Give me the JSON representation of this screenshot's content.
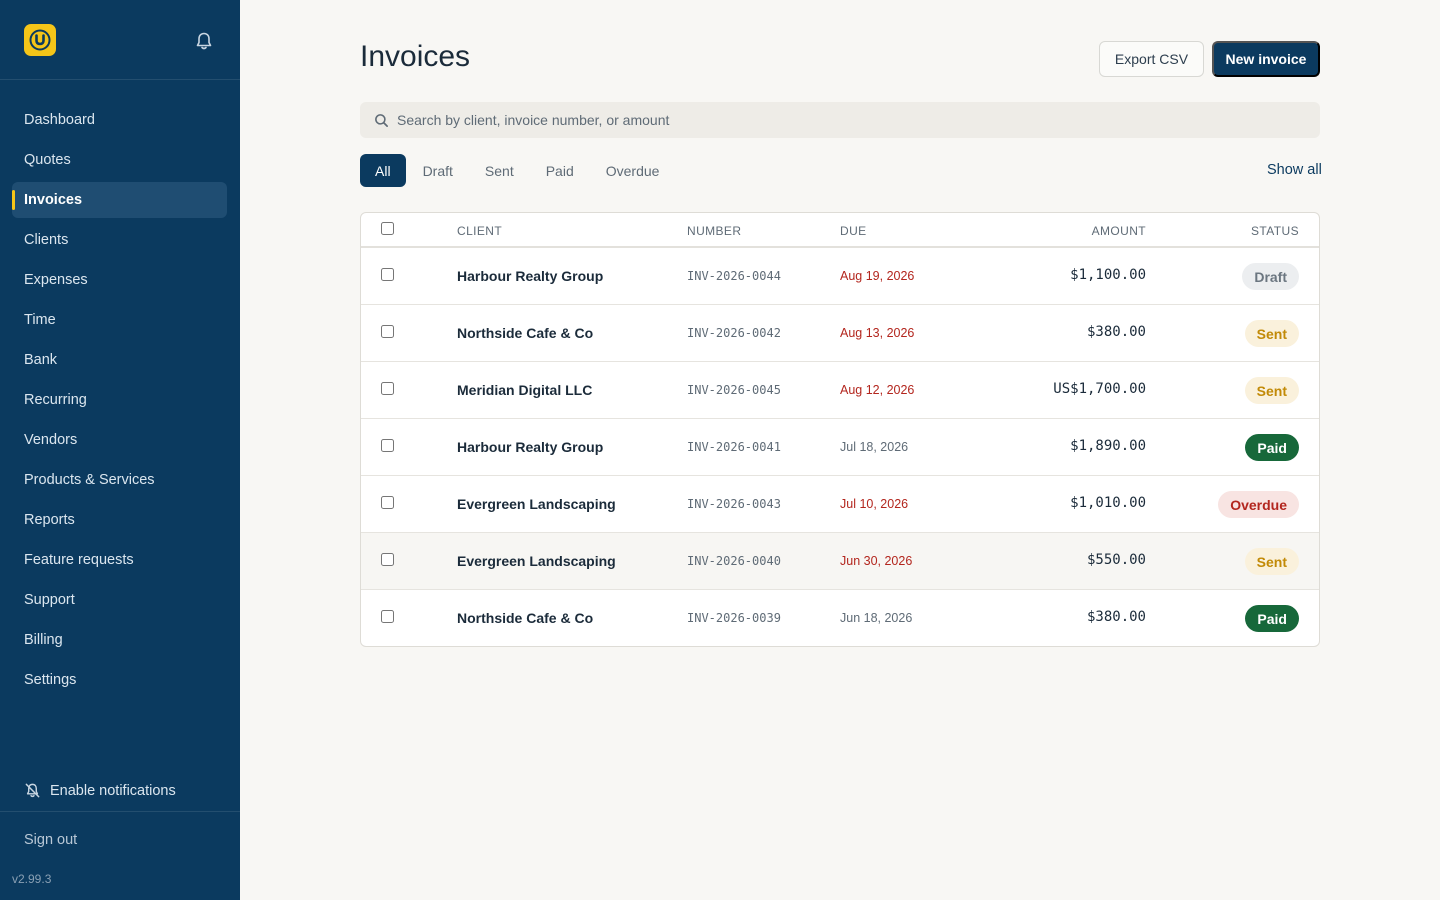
{
  "app": {
    "logo_letter": "U",
    "version": "v2.99.3"
  },
  "sidebar": {
    "items": [
      {
        "label": "Dashboard"
      },
      {
        "label": "Quotes"
      },
      {
        "label": "Invoices",
        "active": true
      },
      {
        "label": "Clients"
      },
      {
        "label": "Expenses"
      },
      {
        "label": "Time"
      },
      {
        "label": "Bank"
      },
      {
        "label": "Recurring"
      },
      {
        "label": "Vendors"
      },
      {
        "label": "Products & Services"
      },
      {
        "label": "Reports"
      },
      {
        "label": "Feature requests"
      },
      {
        "label": "Support"
      },
      {
        "label": "Billing"
      },
      {
        "label": "Settings"
      }
    ],
    "enable_notifications": "Enable notifications",
    "sign_out": "Sign out"
  },
  "header": {
    "title": "Invoices",
    "export_label": "Export CSV",
    "new_label": "New invoice"
  },
  "search": {
    "placeholder": "Search by client, invoice number, or amount",
    "value": ""
  },
  "filters": {
    "tabs": [
      {
        "label": "All",
        "active": true
      },
      {
        "label": "Draft"
      },
      {
        "label": "Sent"
      },
      {
        "label": "Paid"
      },
      {
        "label": "Overdue"
      }
    ],
    "show_all": "Show all"
  },
  "table": {
    "columns": {
      "client": "CLIENT",
      "number": "NUMBER",
      "due": "DUE",
      "amount": "AMOUNT",
      "status": "STATUS"
    },
    "rows": [
      {
        "client": "Harbour Realty Group",
        "number": "INV-2026-0044",
        "due": "Aug 19, 2026",
        "due_late": true,
        "amount": "$1,100.00",
        "status": "Draft",
        "status_key": "draft"
      },
      {
        "client": "Northside Cafe & Co",
        "number": "INV-2026-0042",
        "due": "Aug 13, 2026",
        "due_late": true,
        "amount": "$380.00",
        "status": "Sent",
        "status_key": "sent"
      },
      {
        "client": "Meridian Digital LLC",
        "number": "INV-2026-0045",
        "due": "Aug 12, 2026",
        "due_late": true,
        "amount": "US$1,700.00",
        "status": "Sent",
        "status_key": "sent"
      },
      {
        "client": "Harbour Realty Group",
        "number": "INV-2026-0041",
        "due": "Jul 18, 2026",
        "due_late": false,
        "amount": "$1,890.00",
        "status": "Paid",
        "status_key": "paid"
      },
      {
        "client": "Evergreen Landscaping",
        "number": "INV-2026-0043",
        "due": "Jul 10, 2026",
        "due_late": true,
        "amount": "$1,010.00",
        "status": "Overdue",
        "status_key": "overdue"
      },
      {
        "client": "Evergreen Landscaping",
        "number": "INV-2026-0040",
        "due": "Jun 30, 2026",
        "due_late": true,
        "amount": "$550.00",
        "status": "Sent",
        "status_key": "sent",
        "hover": true
      },
      {
        "client": "Northside Cafe & Co",
        "number": "INV-2026-0039",
        "due": "Jun 18, 2026",
        "due_late": false,
        "amount": "$380.00",
        "status": "Paid",
        "status_key": "paid"
      }
    ]
  },
  "colors": {
    "sidebar_bg": "#0b3a5f",
    "accent_yellow": "#f5c518",
    "late_red": "#b3261e",
    "paid_green": "#17683a",
    "sent_amber": "#c28a07"
  }
}
